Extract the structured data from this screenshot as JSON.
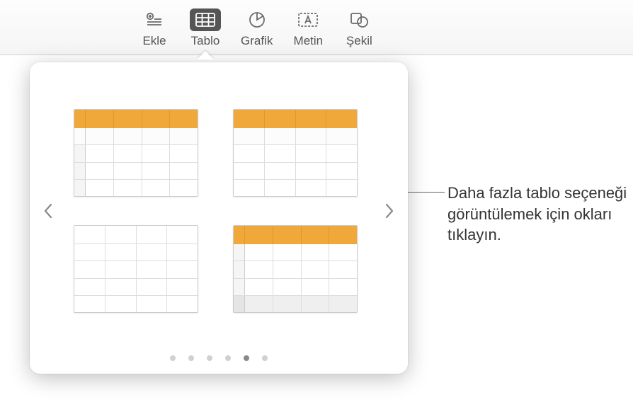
{
  "toolbar": {
    "items": [
      {
        "label": "Ekle"
      },
      {
        "label": "Tablo"
      },
      {
        "label": "Grafik"
      },
      {
        "label": "Metin"
      },
      {
        "label": "Şekil"
      }
    ]
  },
  "popover": {
    "page_count": 6,
    "active_page_index": 4
  },
  "callout": {
    "text": "Daha fazla tablo seçeneği görüntülemek için okları tıklayın."
  }
}
